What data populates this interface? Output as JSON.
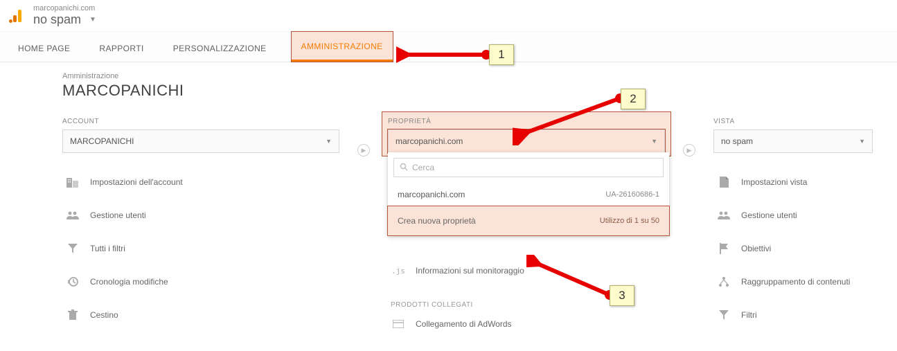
{
  "header": {
    "domain": "marcopanichi.com",
    "account_name": "no spam"
  },
  "tabs": {
    "home": "HOME PAGE",
    "reports": "RAPPORTI",
    "custom": "PERSONALIZZAZIONE",
    "admin": "AMMINISTRAZIONE"
  },
  "breadcrumb": {
    "label": "Amministrazione",
    "title": "MARCOPANICHI"
  },
  "account_col": {
    "label": "ACCOUNT",
    "selected": "MARCOPANICHI",
    "items": {
      "settings": "Impostazioni dell'account",
      "users": "Gestione utenti",
      "filters": "Tutti i filtri",
      "history": "Cronologia modifiche",
      "trash": "Cestino"
    }
  },
  "property_col": {
    "label": "PROPRIETÀ",
    "selected": "marcopanichi.com",
    "search_placeholder": "Cerca",
    "dd_item_name": "marcopanichi.com",
    "dd_item_ua": "UA-26160686-1",
    "create_label": "Crea nuova proprietà",
    "usage": "Utilizzo di 1 su 50",
    "tracking": "Informazioni sul monitoraggio",
    "linked_label": "PRODOTTI COLLEGATI",
    "adwords": "Collegamento di AdWords"
  },
  "view_col": {
    "label": "VISTA",
    "selected": "no spam",
    "items": {
      "view_settings": "Impostazioni vista",
      "users": "Gestione utenti",
      "goals": "Obiettivi",
      "grouping": "Raggruppamento di contenuti",
      "filters": "Filtri"
    }
  },
  "annotations": {
    "n1": "1",
    "n2": "2",
    "n3": "3"
  }
}
